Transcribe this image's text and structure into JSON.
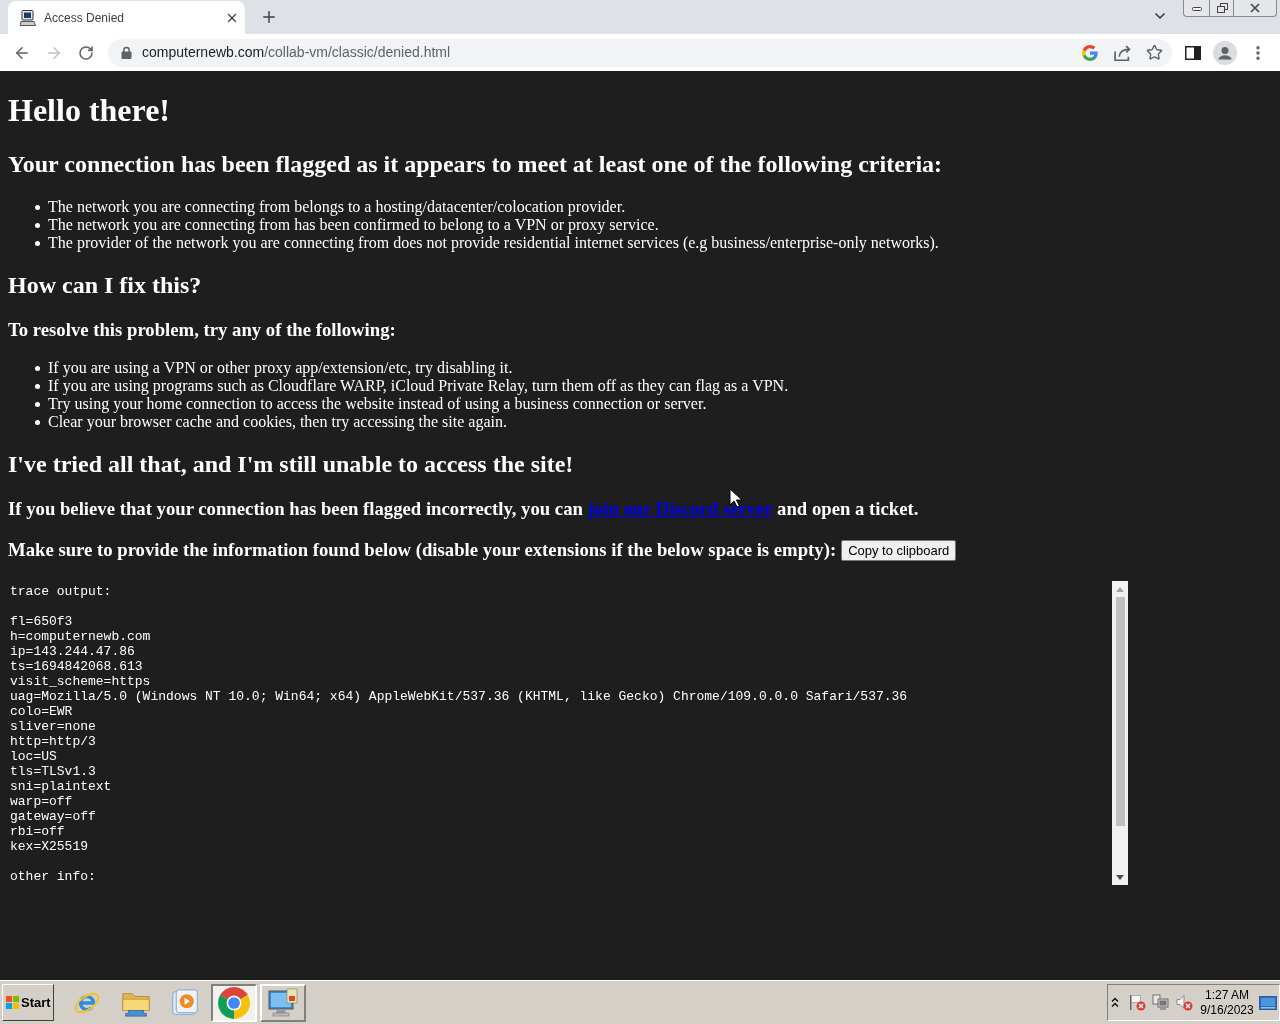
{
  "browser": {
    "tab": {
      "title": "Access Denied",
      "selected": true
    },
    "navigation": {
      "back_disabled": false,
      "forward_disabled": true
    },
    "address": {
      "domain": "computernewb.com",
      "path": "/collab-vm/classic/denied.html"
    }
  },
  "page": {
    "title": "Hello there!",
    "criteria_heading": "Your connection has been flagged as it appears to meet at least one of the following criteria:",
    "criteria": [
      "The network you are connecting from belongs to a hosting/datacenter/colocation provider.",
      "The network you are connecting from has been confirmed to belong to a VPN or proxy service.",
      "The provider of the network you are connecting from does not provide residential internet services (e.g business/enterprise-only networks)."
    ],
    "fix_heading": "How can I fix this?",
    "resolve_heading": "To resolve this problem, try any of the following:",
    "steps": [
      "If you are using a VPN or other proxy app/extension/etc, try disabling it.",
      "If you are using programs such as Cloudflare WARP, iCloud Private Relay, turn them off as they can flag as a VPN.",
      "Try using your home connection to access the website instead of using a business connection or server.",
      "Clear your browser cache and cookies, then try accessing the site again."
    ],
    "still_heading": "I've tried all that, and I'm still unable to access the site!",
    "contact": {
      "before": "If you believe that your connection has been flagged incorrectly, you can",
      "link": "join our Discord server",
      "after": "and open a ticket."
    },
    "provide": {
      "text": "Make sure to provide the information found below (disable your extensions if the below space is empty):",
      "button": "Copy to clipboard"
    },
    "trace": [
      {
        "heading": "trace output:",
        "lines": [
          "fl=650f3",
          "h=computernewb.com",
          "ip=143.244.47.86",
          "ts=1694842068.613",
          "visit_scheme=https",
          "uag=Mozilla/5.0 (Windows NT 10.0; Win64; x64) AppleWebKit/537.36 (KHTML, like Gecko) Chrome/109.0.0.0 Safari/537.36",
          "colo=EWR",
          "sliver=none",
          "http=http/3",
          "loc=US",
          "tls=TLSv1.3",
          "sni=plaintext",
          "warp=off",
          "gateway=off",
          "rbi=off",
          "kex=X25519"
        ]
      },
      {
        "heading": "other info:"
      }
    ]
  },
  "taskbar": {
    "start": "Start",
    "apps": [
      {
        "kind": "ie",
        "running": false,
        "selected": false
      },
      {
        "kind": "explorer",
        "running": false,
        "selected": false
      },
      {
        "kind": "media",
        "running": false,
        "selected": false
      },
      {
        "kind": "chrome",
        "running": true,
        "selected": true
      },
      {
        "kind": "server",
        "running": true,
        "selected": false
      }
    ],
    "clock": {
      "time": "1:27 AM",
      "date": "9/16/2023"
    }
  }
}
